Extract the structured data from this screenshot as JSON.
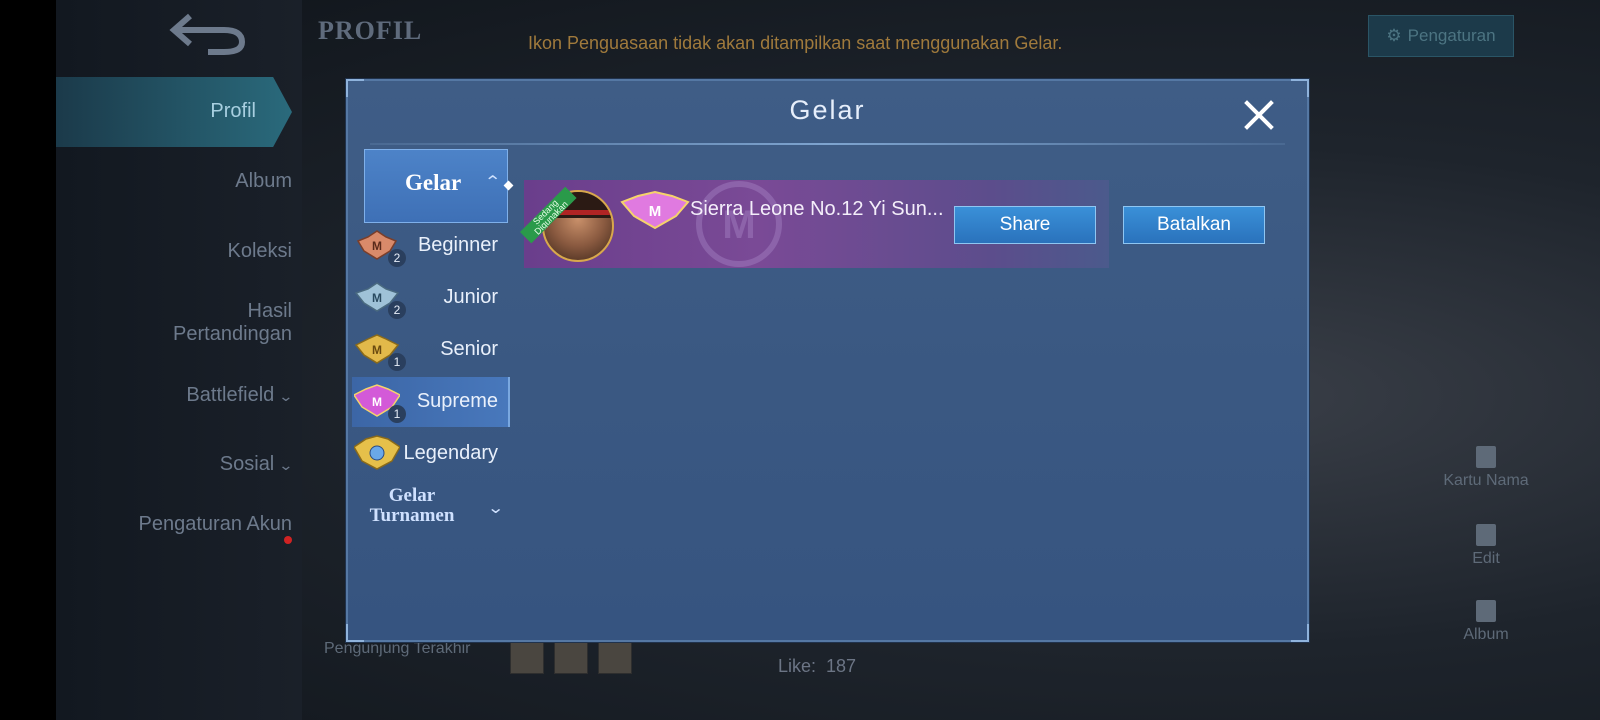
{
  "page": {
    "header": "PROFIL",
    "notice": "Ikon Penguasaan tidak akan ditampilkan saat menggunakan Gelar.",
    "settings_button": "Pengaturan"
  },
  "nav": {
    "items": [
      {
        "label": "Profil",
        "active": true
      },
      {
        "label": "Album"
      },
      {
        "label": "Koleksi"
      },
      {
        "label": "Hasil Pertandingan"
      },
      {
        "label": "Battlefield",
        "chevron": true
      },
      {
        "label": "Sosial",
        "chevron": true
      },
      {
        "label": "Pengaturan Akun",
        "red_dot": true
      }
    ]
  },
  "side_tools": {
    "name_card": "Kartu Nama",
    "edit": "Edit",
    "album": "Album"
  },
  "footer": {
    "visitors_label": "Pengunjung Terakhir",
    "like_label": "Like:",
    "like_value": "187"
  },
  "modal": {
    "title": "Gelar",
    "close_icon": "close-icon",
    "tabs": {
      "gelar": "Gelar",
      "tournament": "Gelar Turnamen"
    },
    "ranks": [
      {
        "label": "Beginner",
        "count": "2",
        "color": "#d98a6a"
      },
      {
        "label": "Junior",
        "count": "2",
        "color": "#9fc2d8"
      },
      {
        "label": "Senior",
        "count": "1",
        "color": "#e2b94a"
      },
      {
        "label": "Supreme",
        "count": "1",
        "color": "#d35ad8",
        "active": true
      },
      {
        "label": "Legendary",
        "count": "",
        "color": "#e6c04a"
      }
    ],
    "selected_title": {
      "ribbon": "Sedang Digunakan",
      "name": "Sierra Leone No.12 Yi Sun...",
      "share": "Share",
      "cancel": "Batalkan"
    }
  },
  "colors": {
    "modal_bg": "#3d5b85",
    "button_blue": "#2f7fc9",
    "title_row_purple": "#6e4290"
  }
}
